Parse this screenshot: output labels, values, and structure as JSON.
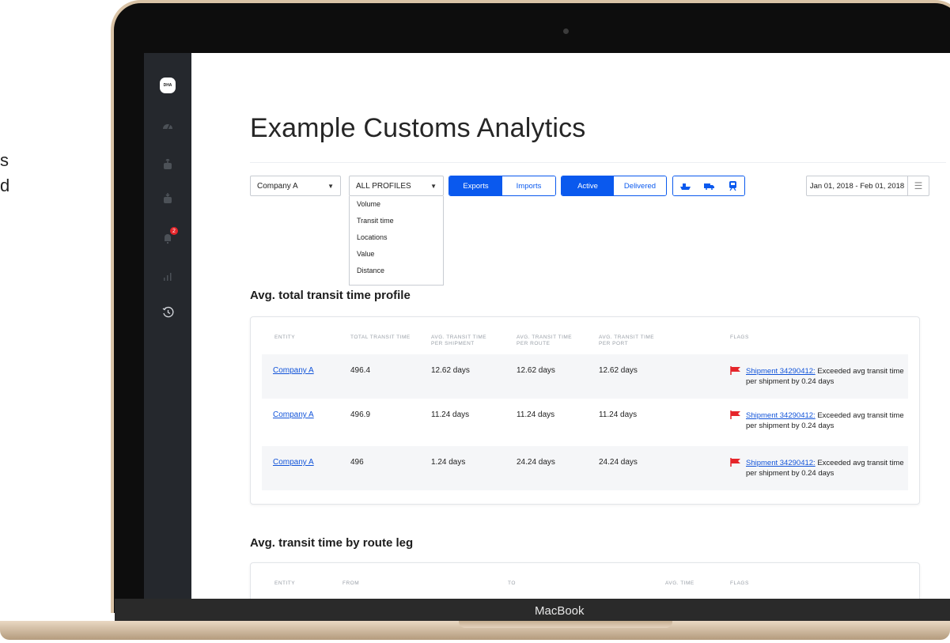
{
  "side_text": {
    "line1": "s",
    "line2": "d"
  },
  "device": {
    "label": "MacBook"
  },
  "sidebar": {
    "logo_text": "DHA",
    "notification_count": "2"
  },
  "page": {
    "title": "Example Customs Analytics"
  },
  "filters": {
    "company_select": "Company A",
    "profile_select": "ALL PROFILES",
    "profile_options": [
      "Volume",
      "Transit time",
      "Locations",
      "Value",
      "Distance"
    ],
    "direction": {
      "exports": "Exports",
      "imports": "Imports"
    },
    "status": {
      "active": "Active",
      "delivered": "Delivered"
    },
    "date_range": "Jan 01, 2018 - Feb 01, 2018"
  },
  "transit_profile": {
    "title": "Avg. total transit time profile",
    "headers": {
      "entity": "ENTITY",
      "total": "TOTAL TRANSIT TIME",
      "per_shipment": "AVG. TRANSIT TIME PER SHIPMENT",
      "per_route": "AVG. TRANSIT TIME PER ROUTE",
      "per_port": "AVG. TRANSIT TIME PER PORT",
      "flags": "FLAGS"
    },
    "rows": [
      {
        "entity": "Company A",
        "total": "496.4",
        "per_shipment": "12.62 days",
        "per_route": "12.62 days",
        "per_port": "12.62 days",
        "flag_link": "Shipment 34290412:",
        "flag_text": " Exceeded avg transit time per shipment by 0.24 days"
      },
      {
        "entity": "Company A",
        "total": "496.9",
        "per_shipment": "11.24 days",
        "per_route": "11.24 days",
        "per_port": "11.24 days",
        "flag_link": "Shipment 34290412:",
        "flag_text": " Exceeded avg transit time per shipment by 0.24 days"
      },
      {
        "entity": "Company A",
        "total": "496",
        "per_shipment": "1.24 days",
        "per_route": "24.24 days",
        "per_port": "24.24 days",
        "flag_link": "Shipment 34290412:",
        "flag_text": " Exceeded avg transit time per shipment by 0.24 days"
      }
    ]
  },
  "route_leg": {
    "title": "Avg. transit time by route leg",
    "headers": {
      "entity": "ENTITY",
      "from": "FROM",
      "to": "TO",
      "avg_time": "AVG. TIME",
      "flags": "FLAGS"
    }
  },
  "colors": {
    "accent": "#0a59ee",
    "sidebar_bg": "#25282d",
    "flag": "#e5252a",
    "link": "#1254d9"
  },
  "icons": {
    "sidebar": [
      "dha-logo-icon",
      "dashboard-icon",
      "export-icon",
      "import-icon",
      "notification-bell-icon",
      "bar-chart-icon",
      "history-icon"
    ],
    "transport_modes": [
      "ship-icon",
      "truck-icon",
      "train-icon"
    ]
  }
}
